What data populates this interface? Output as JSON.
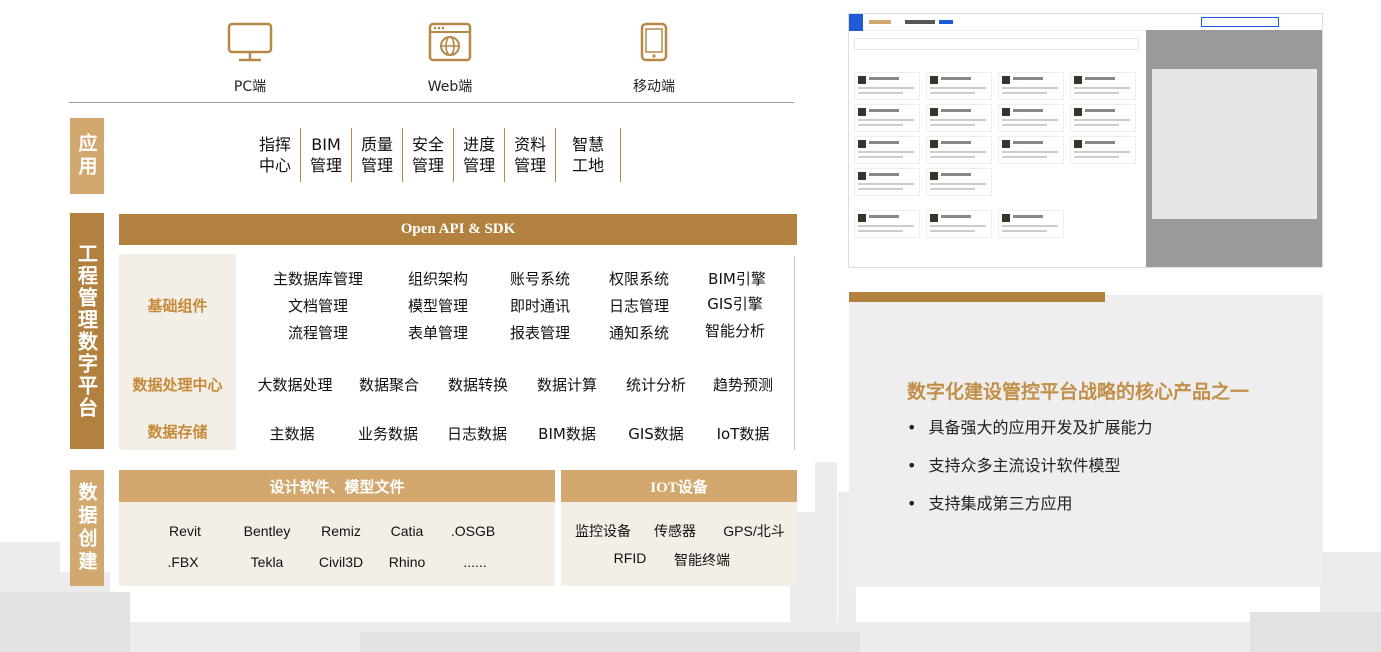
{
  "devices": [
    {
      "label": "PC端",
      "icon": "monitor-icon"
    },
    {
      "label": "Web端",
      "icon": "web-browser-icon"
    },
    {
      "label": "移动端",
      "icon": "mobile-phone-icon"
    }
  ],
  "sides": {
    "app": "应用",
    "platform": "工程管理数字平台",
    "data": "数据创建"
  },
  "apps": [
    "指挥\n中心",
    "BIM\n管理",
    "质量\n管理",
    "安全\n管理",
    "进度\n管理",
    "资料\n管理",
    "智慧\n工地"
  ],
  "platform": {
    "api_bar": "Open API & SDK",
    "basic": {
      "label": "基础组件",
      "rows": [
        [
          "主数据库管理",
          "组织架构",
          "账号系统",
          "权限系统",
          "BIM引擎"
        ],
        [
          "文档管理",
          "模型管理",
          "即时通讯",
          "日志管理",
          "GIS引擎"
        ],
        [
          "流程管理",
          "表单管理",
          "报表管理",
          "通知系统",
          "智能分析"
        ]
      ]
    },
    "processing": {
      "label": "数据处理中心",
      "items": [
        "大数据处理",
        "数据聚合",
        "数据转换",
        "数据计算",
        "统计分析",
        "趋势预测"
      ]
    },
    "storage": {
      "label": "数据存储",
      "items": [
        "主数据",
        "业务数据",
        "日志数据",
        "BIM数据",
        "GIS数据",
        "IoT数据"
      ]
    }
  },
  "creation": {
    "design": {
      "title": "设计软件、模型文件",
      "rows": [
        [
          "Revit",
          "Bentley",
          "Remiz",
          "Catia",
          ".OSGB"
        ],
        [
          ".FBX",
          "Tekla",
          "Civil3D",
          "Rhino",
          "......"
        ]
      ]
    },
    "iot": {
      "title": "IOT设备",
      "rows": [
        [
          "监控设备",
          "传感器",
          "GPS/北斗"
        ],
        [
          "RFID",
          "智能终端"
        ]
      ]
    }
  },
  "info": {
    "title": "数字化建设管控平台战略的核心产品之一",
    "bullets": [
      "具备强大的应用开发及扩展能力",
      "支持众多主流设计软件模型",
      "支持集成第三方应用"
    ]
  },
  "colors": {
    "gold": "#b2803f",
    "gold_light": "#d3a86e",
    "beige": "#f4efe6",
    "title_gold": "#c28f48"
  }
}
